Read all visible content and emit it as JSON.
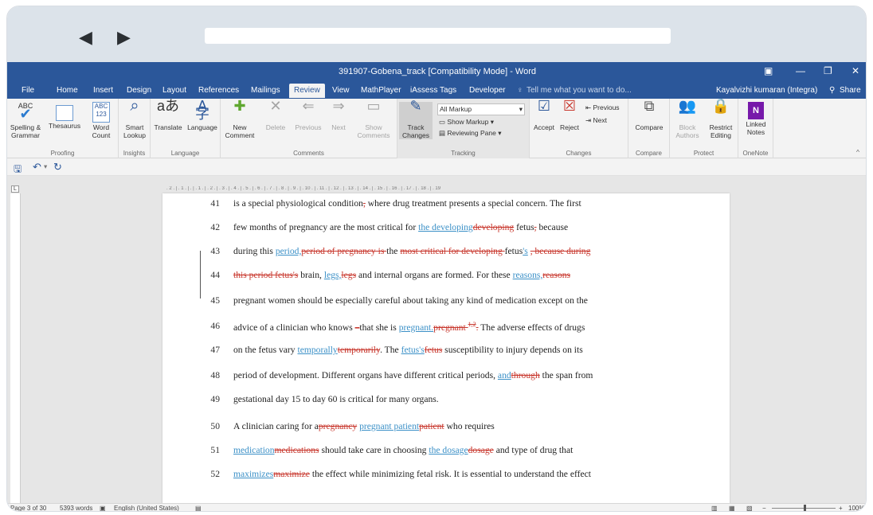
{
  "browser": {
    "back_icon": "back-arrow-icon",
    "forward_icon": "forward-arrow-icon",
    "url": ""
  },
  "window": {
    "title": "391907-Gobena_track [Compatibility Mode] - Word",
    "user": "Kayalvizhi kumaran (Integra)",
    "share": "Share"
  },
  "tabs": [
    "File",
    "Home",
    "Insert",
    "Design",
    "Layout",
    "References",
    "Mailings",
    "Review",
    "View",
    "MathPlayer",
    "iAssess Tags",
    "Developer"
  ],
  "active_tab": "Review",
  "tell_me": "Tell me what you want to do...",
  "ribbon": {
    "proofing": {
      "label": "Proofing",
      "spelling": "Spelling & Grammar",
      "thesaurus": "Thesaurus",
      "wordcount": "Word Count"
    },
    "insights": {
      "label": "Insights",
      "smart": "Smart Lookup"
    },
    "language": {
      "label": "Language",
      "translate": "Translate",
      "language": "Language"
    },
    "comments": {
      "label": "Comments",
      "new": "New Comment",
      "delete": "Delete",
      "previous": "Previous",
      "next": "Next",
      "show": "Show Comments"
    },
    "tracking": {
      "label": "Tracking",
      "track": "Track Changes",
      "markup": "All Markup",
      "show_markup": "Show Markup",
      "reviewing": "Reviewing Pane"
    },
    "changes": {
      "label": "Changes",
      "accept": "Accept",
      "reject": "Reject",
      "previous": "Previous",
      "next": "Next"
    },
    "compare": {
      "label": "Compare",
      "compare": "Compare"
    },
    "protect": {
      "label": "Protect",
      "block": "Block Authors",
      "restrict": "Restrict Editing"
    },
    "onenote": {
      "label": "OneNote",
      "linked": "Linked Notes"
    }
  },
  "ruler": ". 2 . | . 1 . | . | . 1 . | . 2 . | . 3 . | . 4 . | . 5 . | . 6 . | . 7 . | . 8 . | . 9 . | . 10 . | . 11 . | . 12 . | . 13 . | . 14 . | . 15 . | . 16 . | . 17 . | . 18 . | . 19",
  "lines": [
    {
      "n": "41",
      "parts": [
        [
          "n",
          "is a special physiological condition"
        ],
        [
          "d",
          ","
        ],
        [
          "n",
          " where drug treatment presents a special concern. The first"
        ]
      ]
    },
    {
      "n": "42",
      "parts": [
        [
          "n",
          "few months of pregnancy are the most critical for "
        ],
        [
          "i",
          "the developing"
        ],
        [
          "d",
          "developing"
        ],
        [
          "n",
          " fetus"
        ],
        [
          "d",
          ","
        ],
        [
          "n",
          " because"
        ]
      ]
    },
    {
      "n": "43",
      "parts": [
        [
          "n",
          "during this "
        ],
        [
          "i",
          "period,"
        ],
        [
          "d",
          "period of pregnancy is "
        ],
        [
          "n",
          "the "
        ],
        [
          "d",
          "most critical for developing "
        ],
        [
          "n",
          "fetus"
        ],
        [
          "i",
          "'s"
        ],
        [
          "n",
          " "
        ],
        [
          "d",
          ", because during"
        ]
      ]
    },
    {
      "n": "44",
      "parts": [
        [
          "d",
          "this period fetus's"
        ],
        [
          "n",
          " brain, "
        ],
        [
          "i",
          "legs,"
        ],
        [
          "d",
          "legs"
        ],
        [
          "n",
          " and internal organs are formed. For these "
        ],
        [
          "i",
          "reasons,"
        ],
        [
          "d",
          "reasons"
        ]
      ]
    },
    {
      "n": "45",
      "parts": [
        [
          "n",
          "pregnant women should be especially careful about taking any kind of medication except on the"
        ]
      ]
    },
    {
      "n": "46",
      "parts": [
        [
          "n",
          "advice of a clinician who knows "
        ],
        [
          "d",
          "–"
        ],
        [
          "n",
          "that she is "
        ],
        [
          "i",
          "pregnant."
        ],
        [
          "d",
          "pregnant "
        ],
        [
          "d",
          "1,2"
        ],
        [
          "d",
          "."
        ],
        [
          "n",
          " The adverse effects of drugs"
        ]
      ]
    },
    {
      "n": "47",
      "parts": [
        [
          "n",
          "on the fetus vary "
        ],
        [
          "i",
          "temporally"
        ],
        [
          "d",
          "temporarily"
        ],
        [
          "n",
          ". The "
        ],
        [
          "i",
          "fetus's"
        ],
        [
          "d",
          "fetus"
        ],
        [
          "n",
          " susceptibility to injury depends on its"
        ]
      ]
    },
    {
      "n": "48",
      "parts": [
        [
          "n",
          "period of development. Different organs have different critical periods, "
        ],
        [
          "i",
          "and"
        ],
        [
          "d",
          "through"
        ],
        [
          "n",
          " the span from"
        ]
      ]
    },
    {
      "n": "49",
      "parts": [
        [
          "n",
          "gestational day 15 to day 60 is critical for many organs."
        ]
      ]
    },
    {
      "n": "50",
      "parts": [
        [
          "n",
          "        A  clinician  caring  for  a"
        ],
        [
          "d",
          "pregnancy"
        ],
        [
          "n",
          "  "
        ],
        [
          "i",
          "pregnant  patient"
        ],
        [
          "d",
          "patient"
        ],
        [
          "n",
          "  who  requires"
        ]
      ]
    },
    {
      "n": "51",
      "parts": [
        [
          "i",
          "medication"
        ],
        [
          "d",
          "medications"
        ],
        [
          "n",
          " should take care in choosing "
        ],
        [
          "i",
          "the dosage"
        ],
        [
          "d",
          "dosage"
        ],
        [
          "n",
          " and type of drug that"
        ]
      ]
    },
    {
      "n": "52",
      "parts": [
        [
          "i",
          "maximizes"
        ],
        [
          "d",
          "maximize"
        ],
        [
          "n",
          " the effect while minimizing fetal risk. It is essential to understand the effect"
        ]
      ]
    }
  ],
  "status": {
    "page": "Page 3 of 30",
    "words": "5393 words",
    "language": "English (United States)",
    "zoom": "100%"
  },
  "colors": {
    "word_blue": "#2b579a",
    "insert": "#3b90c7",
    "delete": "#c8372d"
  }
}
